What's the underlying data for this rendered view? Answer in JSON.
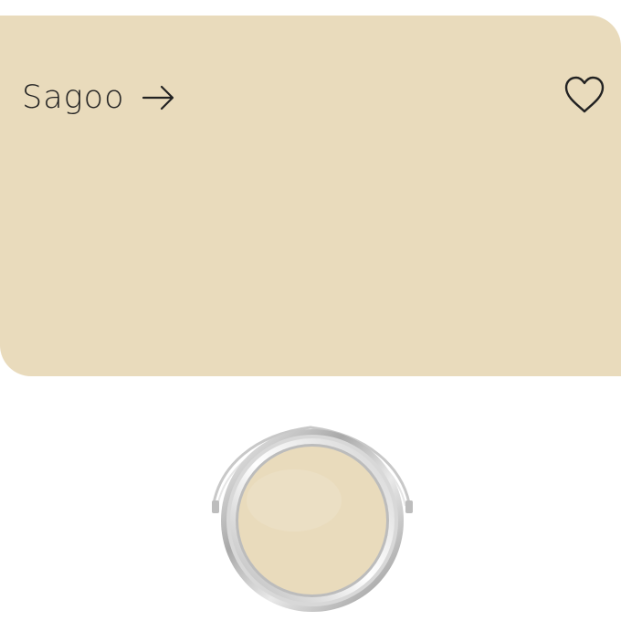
{
  "swatch": {
    "name": "Sagoo",
    "color": "#e9dbbc",
    "arrow_icon": "arrow-right-icon",
    "favorite_icon": "heart-outline-icon"
  },
  "product": {
    "image": "paint-can-icon",
    "paint_color": "#e9dbbc"
  }
}
